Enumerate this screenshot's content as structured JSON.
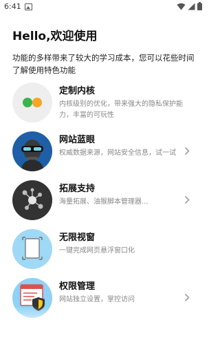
{
  "status_bar": {
    "time": "6:41",
    "icons": [
      "gallery-icon",
      "wifi-icon",
      "signal-icon",
      "battery-icon"
    ]
  },
  "page": {
    "title": "Hello,欢迎使用",
    "description": "功能的多样带来了较大的学习成本，您可以花些时间了解使用特色功能"
  },
  "features": [
    {
      "name": "定制内核",
      "desc": "内核级别的优化，带来强大的隐私保护能力，丰富的可玩性",
      "icon": "custom-kernel-icon",
      "has_arrow": false
    },
    {
      "name": "网站蓝眼",
      "desc": "权威数据来源，网站安全信息，试一试",
      "icon": "site-blue-eye-icon",
      "has_arrow": true
    },
    {
      "name": "拓展支持",
      "desc": "海量拓展、油猴脚本管理器...",
      "icon": "extension-support-icon",
      "has_arrow": true
    },
    {
      "name": "无限视窗",
      "desc": "一键完成网页悬浮窗口化",
      "icon": "infinite-window-icon",
      "has_arrow": false
    },
    {
      "name": "权限管理",
      "desc": "网站独立设置，掌控访问",
      "icon": "permission-management-icon",
      "has_arrow": true
    }
  ],
  "colors": {
    "kernel_bg": "#eeeeee",
    "kernel_green": "#3bb44a",
    "kernel_orange": "#f5a623",
    "blue_eye_bg": "#1e5fa8",
    "extension_bg": "#333333",
    "window_bg": "#9fd9f5",
    "permission_bg": "#8fd2f5",
    "text_secondary": "#888888",
    "chevron": "#9e9e9e"
  }
}
